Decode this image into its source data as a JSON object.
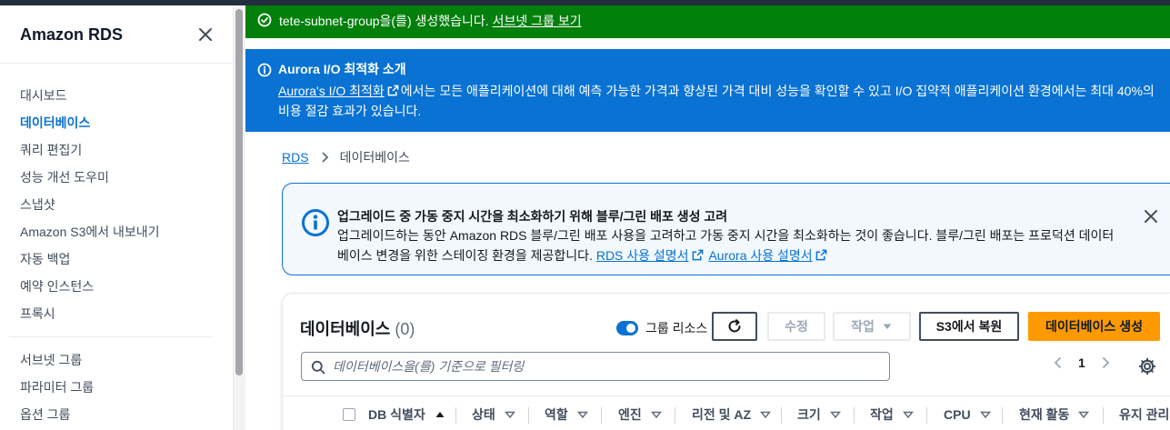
{
  "sidebar": {
    "title": "Amazon RDS",
    "items_top": [
      "대시보드",
      "데이터베이스",
      "쿼리 편집기",
      "성능 개선 도우미",
      "스냅샷",
      "Amazon S3에서 내보내기",
      "자동 백업",
      "예약 인스턴스",
      "프록시"
    ],
    "active_item": "데이터베이스",
    "items_bottom": [
      "서브넷 그룹",
      "파라미터 그룹",
      "옵션 그룹"
    ]
  },
  "flash_success": {
    "message": "tete-subnet-group을(를) 생성했습니다.",
    "link": "서브넷 그룹 보기",
    "color": "#037f0c"
  },
  "flash_info": {
    "title": "Aurora I/O 최적화 소개",
    "link": "Aurora's I/O 최적화",
    "body": "에서는 모든 애플리케이션에 대해 예측 가능한 가격과 향상된 가격 대비 성능을 확인할 수 있고 I/O 집약적 애플리케이션 환경에서는 최대 40%의 비용 절감 효과가 있습니다.",
    "color": "#0972d3"
  },
  "breadcrumb": {
    "root": "RDS",
    "current": "데이터베이스"
  },
  "alert": {
    "title": "업그레이드 중 가동 중지 시간을 최소화하기 위해 블루/그린 배포 생성 고려",
    "body": "업그레이드하는 동안 Amazon RDS 블루/그린 배포 사용을 고려하고 가동 중지 시간을 최소화하는 것이 좋습니다. 블루/그린 배포는 프로덕션 데이터베이스 변경을 위한 스테이징 환경을 제공합니다.",
    "link_rds": "RDS 사용 설명서",
    "link_aurora": "Aurora 사용 설명서"
  },
  "panel": {
    "title": "데이터베이스",
    "count": "(0)",
    "toggle_label": "그룹 리소스",
    "toggle_on": true,
    "btn_modify": "수정",
    "btn_actions": "작업",
    "btn_restore": "S3에서 복원",
    "btn_create": "데이터베이스 생성",
    "search_placeholder": "데이터베이스을(를) 기준으로 필터링",
    "page": "1",
    "columns": [
      "DB 식별자",
      "상태",
      "역할",
      "엔진",
      "리전 및 AZ",
      "크기",
      "작업",
      "CPU",
      "현재 활동",
      "유지 관리"
    ],
    "accent": "#ff9900"
  }
}
